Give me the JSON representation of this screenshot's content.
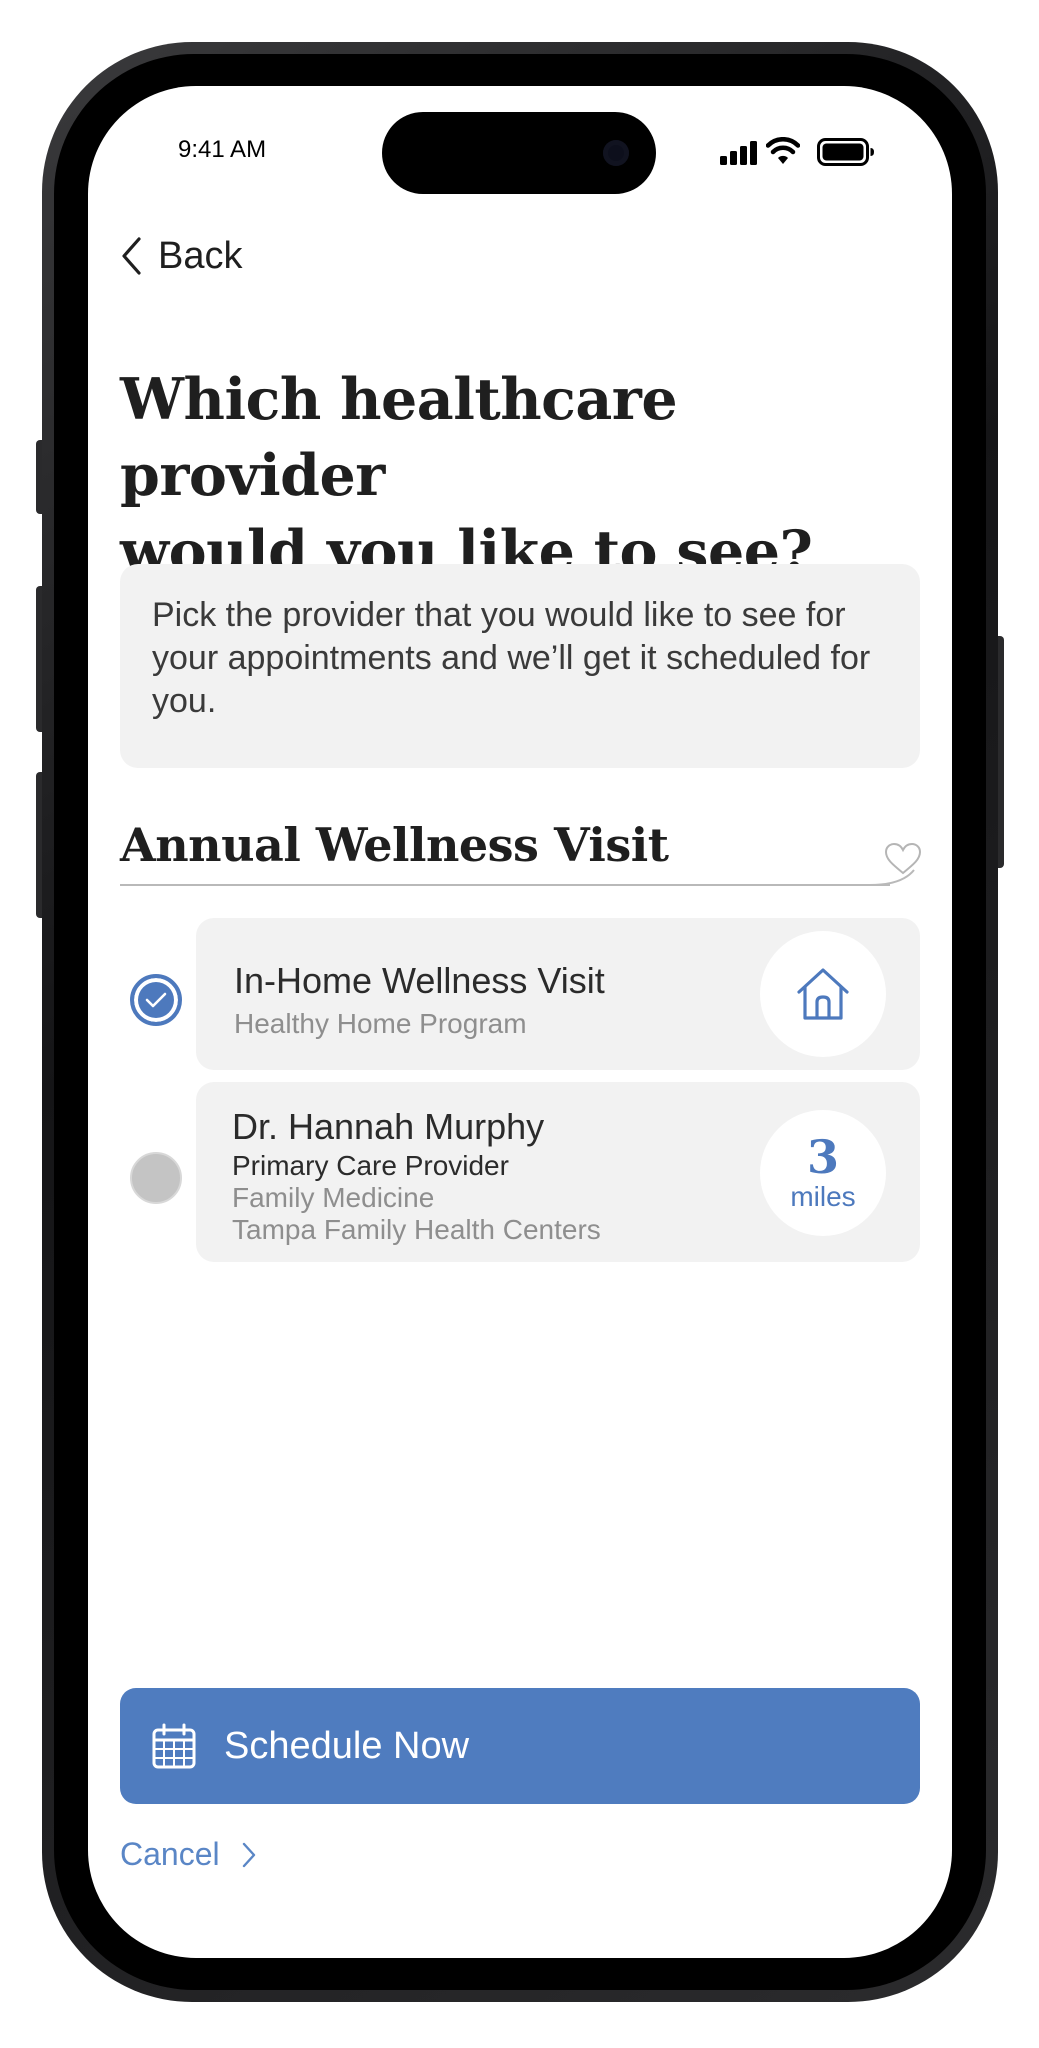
{
  "status_bar": {
    "time": "9:41 AM"
  },
  "nav": {
    "back_label": "Back"
  },
  "page": {
    "title_line1": "Which healthcare provider",
    "title_line2": "would you like to see?",
    "info_text": "Pick the provider that you would like to see for your appointments and we’ll get it scheduled for you."
  },
  "section": {
    "title": "Annual Wellness Visit"
  },
  "options": [
    {
      "title": "In-Home Wellness Visit",
      "subtitle": "Healthy Home Program",
      "badge_icon": "home-icon",
      "selected": true
    },
    {
      "name": "Dr. Hannah Murphy",
      "role": "Primary Care Provider",
      "specialty": "Family Medicine",
      "organization": "Tampa Family Health Centers",
      "distance_value": "3",
      "distance_unit": "miles",
      "selected": false
    }
  ],
  "actions": {
    "schedule_label": "Schedule Now",
    "cancel_label": "Cancel"
  },
  "colors": {
    "accent": "#4f7cbf",
    "card_bg": "#f2f2f2",
    "text": "#1f1f1f"
  }
}
